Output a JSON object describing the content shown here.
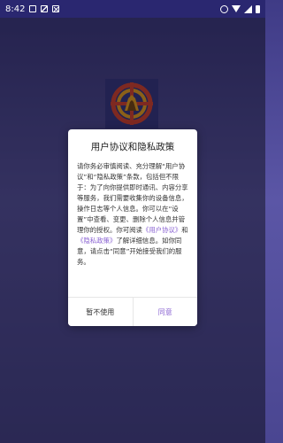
{
  "status_bar": {
    "time": "8:42",
    "icons_left": [
      "notification-square-icon",
      "image-icon",
      "close-box-icon"
    ],
    "icons_right": [
      "do-not-disturb-icon",
      "wifi-icon",
      "signal-icon",
      "battery-icon"
    ]
  },
  "logo": {
    "icon": "app-logo-icon"
  },
  "dialog": {
    "title": "用户协议和隐私政策",
    "body_part1": "请你务必审慎阅读、充分理解“用户协议”和“隐私政策”条款，包括但不限于：为了向你提供即时通讯、内容分享等服务，我们需要收集你的设备信息，操作日志等个人信息。你可以在“设置”中查看、变更、删除个人信息并管理你的授权。你可阅读",
    "link_user_agreement": "《用户协议》",
    "body_and": "和",
    "link_privacy_policy": "《隐私政策》",
    "body_part2": "了解详细信息。如你同意，请点击“同意”开始接受我们的服务。",
    "decline_label": "暂不使用",
    "agree_label": "同意"
  },
  "colors": {
    "accent": "#8a63d2",
    "background_top": "#3f3b86",
    "logo_background": "#3b3b8c"
  }
}
